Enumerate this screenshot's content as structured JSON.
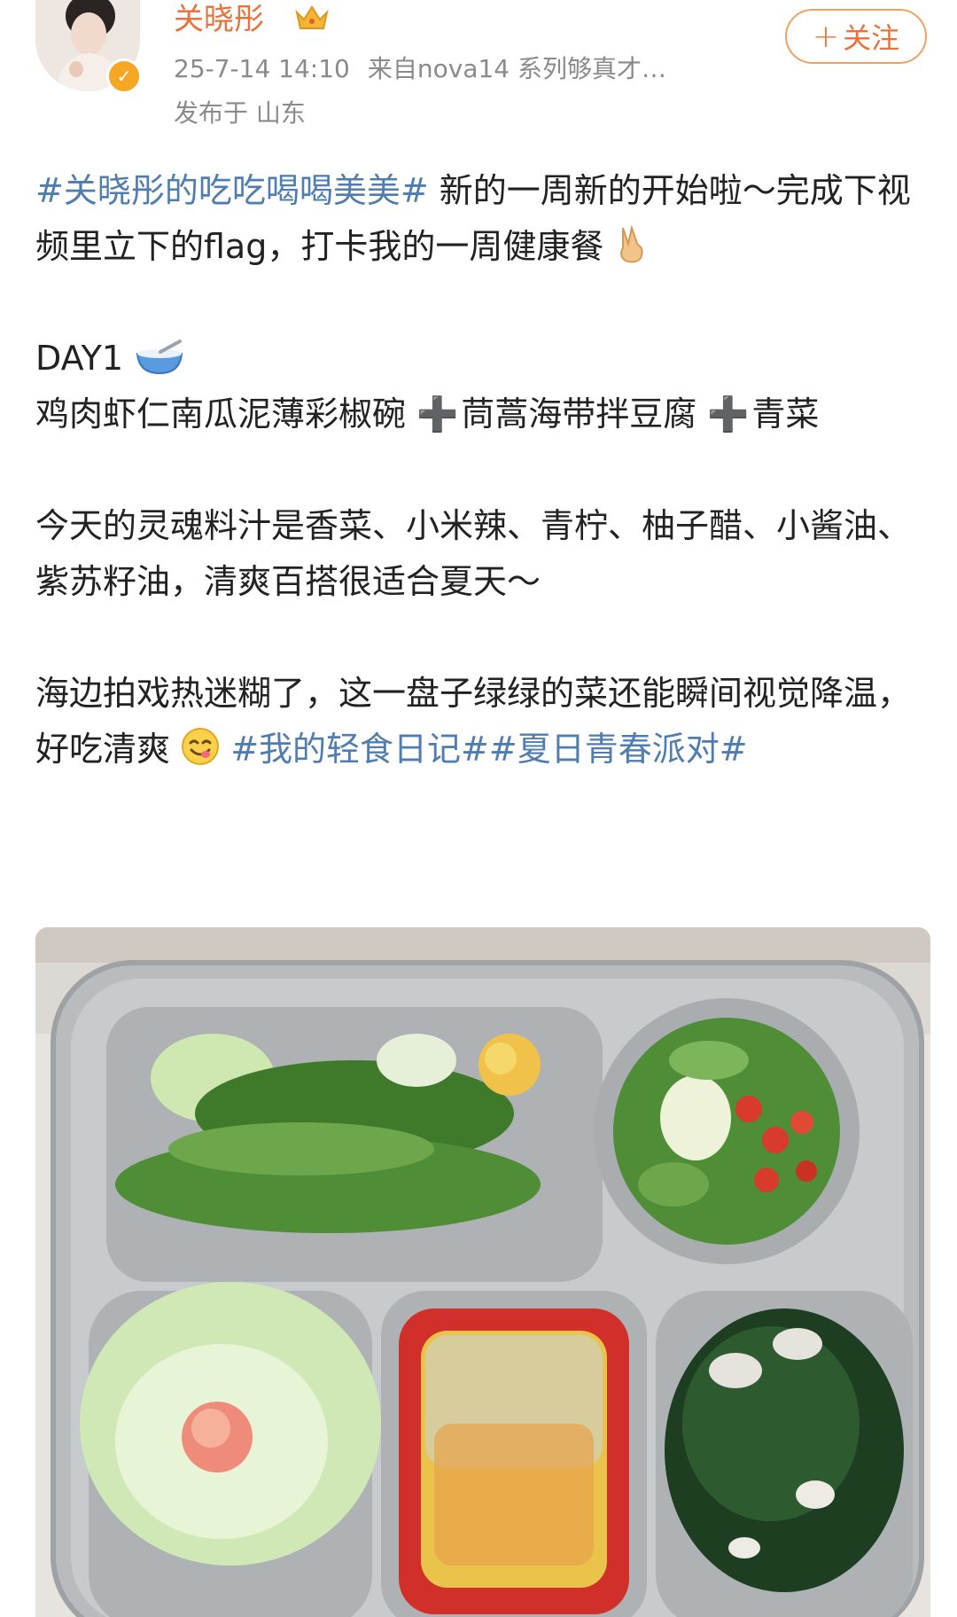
{
  "post": {
    "author": {
      "name": "关晓彤",
      "avatar_icon": "user-avatar",
      "verified_icon": "verified-badge-icon",
      "crown_icon": "crown-icon"
    },
    "timestamp": "25-7-14 14:10",
    "source_label": "来自",
    "source": "nova14 系列够真才…",
    "location": "发布于 山东",
    "follow_button": {
      "plus": "+",
      "label": "关注"
    },
    "body": {
      "p1_tag": "#关晓彤的吃吃喝喝美美#",
      "p1_text": "新的一周新的开始啦～完成下视频里立下的flag，打卡我的一周健康餐",
      "p1_emoji": "victory-hand-emoji",
      "day": "DAY1",
      "day_emoji": "bowl-spoon-emoji",
      "dish1": "鸡肉虾仁南瓜泥薄彩椒碗",
      "dish2": "茼蒿海带拌豆腐",
      "dish3": "青菜",
      "plus_symbol": "➕",
      "p3": "今天的灵魂料汁是香菜、小米辣、青柠、柚子醋、小酱油、紫苏籽油，清爽百搭很适合夏天～",
      "p4_text": "海边拍戏热迷糊了，这一盘子绿绿的菜还能瞬间视觉降温，好吃清爽",
      "p4_emoji": "yum-face-emoji",
      "p4_tag1": "#我的轻食日记#",
      "p4_tag2": "#夏日青春派对#"
    },
    "image": {
      "icon": "food-photo"
    },
    "colors": {
      "username": "#e8733a",
      "tag": "#507daf",
      "meta": "#8a8a8a"
    }
  }
}
